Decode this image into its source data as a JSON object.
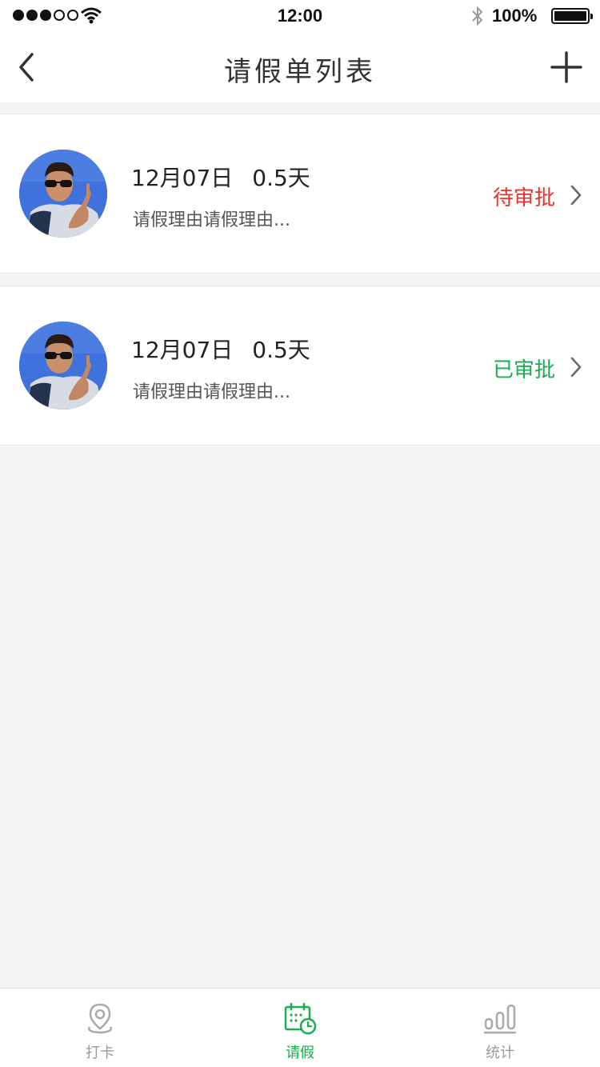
{
  "status_bar": {
    "time": "12:00",
    "battery": "100%",
    "signal_icon": "signal-dots-icon",
    "wifi_icon": "wifi-icon",
    "bluetooth_icon": "bluetooth-icon",
    "battery_icon": "battery-icon"
  },
  "nav": {
    "title": "请假单列表",
    "back_icon": "chevron-left-icon",
    "add_icon": "plus-icon"
  },
  "leave_list": [
    {
      "date": "12月07日",
      "days": "0.5天",
      "reason": "请假理由请假理由...",
      "status": "待审批",
      "status_color": "#e8322f"
    },
    {
      "date": "12月07日",
      "days": "0.5天",
      "reason": "请假理由请假理由...",
      "status": "已审批",
      "status_color": "#1aad50"
    }
  ],
  "tabs": [
    {
      "label": "打卡",
      "icon": "location-pin-icon",
      "active": false
    },
    {
      "label": "请假",
      "icon": "calendar-clock-icon",
      "active": true
    },
    {
      "label": "统计",
      "icon": "bar-chart-icon",
      "active": false
    }
  ],
  "colors": {
    "accent": "#1aad50",
    "pending": "#e8322f",
    "background": "#f4f4f4"
  }
}
